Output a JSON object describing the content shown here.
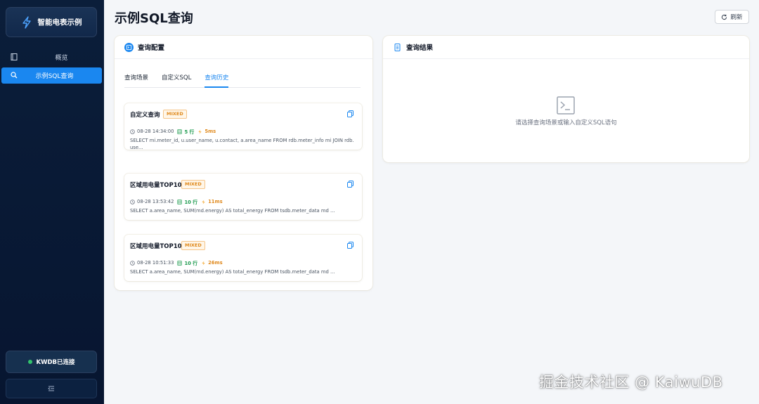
{
  "app": {
    "name": "智能电表示例"
  },
  "sidebar": {
    "items": [
      {
        "label": "概览",
        "icon": "book-icon"
      },
      {
        "label": "示例SQL查询",
        "icon": "search-icon",
        "active": true
      }
    ],
    "status": "KWDB已连接",
    "status_color": "#32c36c"
  },
  "header": {
    "title": "示例SQL查询",
    "refresh_label": "刷新"
  },
  "config": {
    "title": "查询配置",
    "tabs": [
      "查询场景",
      "自定义SQL",
      "查询历史"
    ],
    "active_tab": 2,
    "history": [
      {
        "title": "自定义查询",
        "badge": "MIXED",
        "time": "08-28 14:34:00",
        "rows": "5 行",
        "duration": "5ms",
        "sql": "SELECT mi.meter_id, u.user_name, u.contact, a.area_name FROM rdb.meter_info mi JOIN rdb.use..."
      },
      {
        "title": "区域用电量TOP10",
        "badge": "MIXED",
        "time": "08-28 13:53:42",
        "rows": "10 行",
        "duration": "11ms",
        "sql": "SELECT a.area_name, SUM(md.energy) AS total_energy FROM tsdb.meter_data md ..."
      },
      {
        "title": "区域用电量TOP10",
        "badge": "MIXED",
        "time": "08-28 10:51:33",
        "rows": "10 行",
        "duration": "26ms",
        "sql": "SELECT a.area_name, SUM(md.energy) AS total_energy FROM tsdb.meter_data md ..."
      }
    ]
  },
  "result": {
    "title": "查询结果",
    "empty_text": "请选择查询场景或输入自定义SQL语句"
  },
  "watermark": "掘金技术社区 @ KaiwuDB",
  "colors": {
    "accent": "#1a87f0",
    "sidebar_bg": "#0b1e3a",
    "badge": "#e08a1e",
    "rows": "#1e9b4f"
  }
}
